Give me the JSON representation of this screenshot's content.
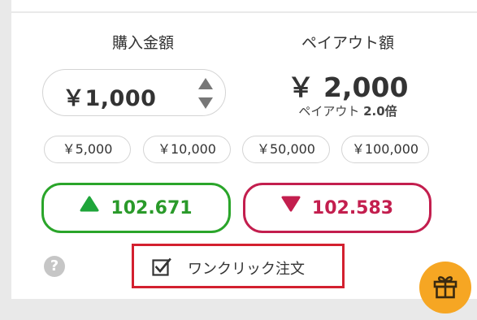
{
  "purchase": {
    "title": "購入金額",
    "amount": "￥1,000"
  },
  "payout": {
    "title": "ペイアウト額",
    "amount": "￥ 2,000",
    "rate_label": "ペイアウト",
    "rate_value": "2.0倍"
  },
  "quick_amounts": [
    "￥5,000",
    "￥10,000",
    "￥50,000",
    "￥100,000"
  ],
  "trade": {
    "high_value": "102.671",
    "low_value": "102.583"
  },
  "one_click": {
    "label": "ワンクリック注文",
    "checked": true
  },
  "help_text": "?",
  "colors": {
    "high": "#2aa52a",
    "low": "#c31e4e",
    "highlight_border": "#d3202f",
    "gift": "#f6a623"
  }
}
